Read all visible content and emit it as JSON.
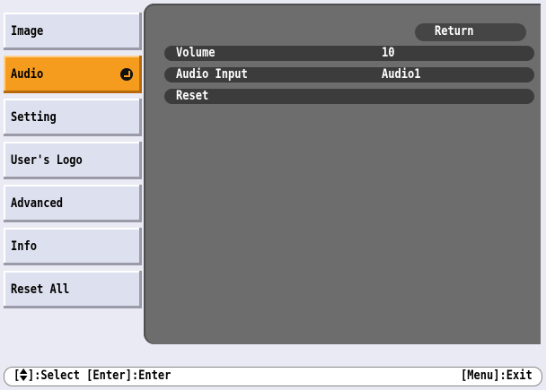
{
  "sidebar": {
    "items": [
      {
        "label": "Image",
        "selected": false
      },
      {
        "label": "Audio",
        "selected": true
      },
      {
        "label": "Setting",
        "selected": false
      },
      {
        "label": "User's Logo",
        "selected": false
      },
      {
        "label": "Advanced",
        "selected": false
      },
      {
        "label": "Info",
        "selected": false
      },
      {
        "label": "Reset All",
        "selected": false
      }
    ],
    "selected_icon": "enter-icon"
  },
  "main": {
    "return_label": "Return",
    "items": [
      {
        "label": "Volume",
        "value": "10"
      },
      {
        "label": "Audio Input",
        "value": "Audio1"
      },
      {
        "label": "Reset",
        "value": ""
      }
    ]
  },
  "footer": {
    "select_label": "]:Select [Enter]:Enter",
    "exit_label": "[Menu]:Exit",
    "nav_icon": "up-down-arrow-icon"
  },
  "colors": {
    "panel": "#6d6d6d",
    "selected_tab": "#f59c1f",
    "tab": "#dde0ee",
    "background": "#e9eaf3"
  }
}
